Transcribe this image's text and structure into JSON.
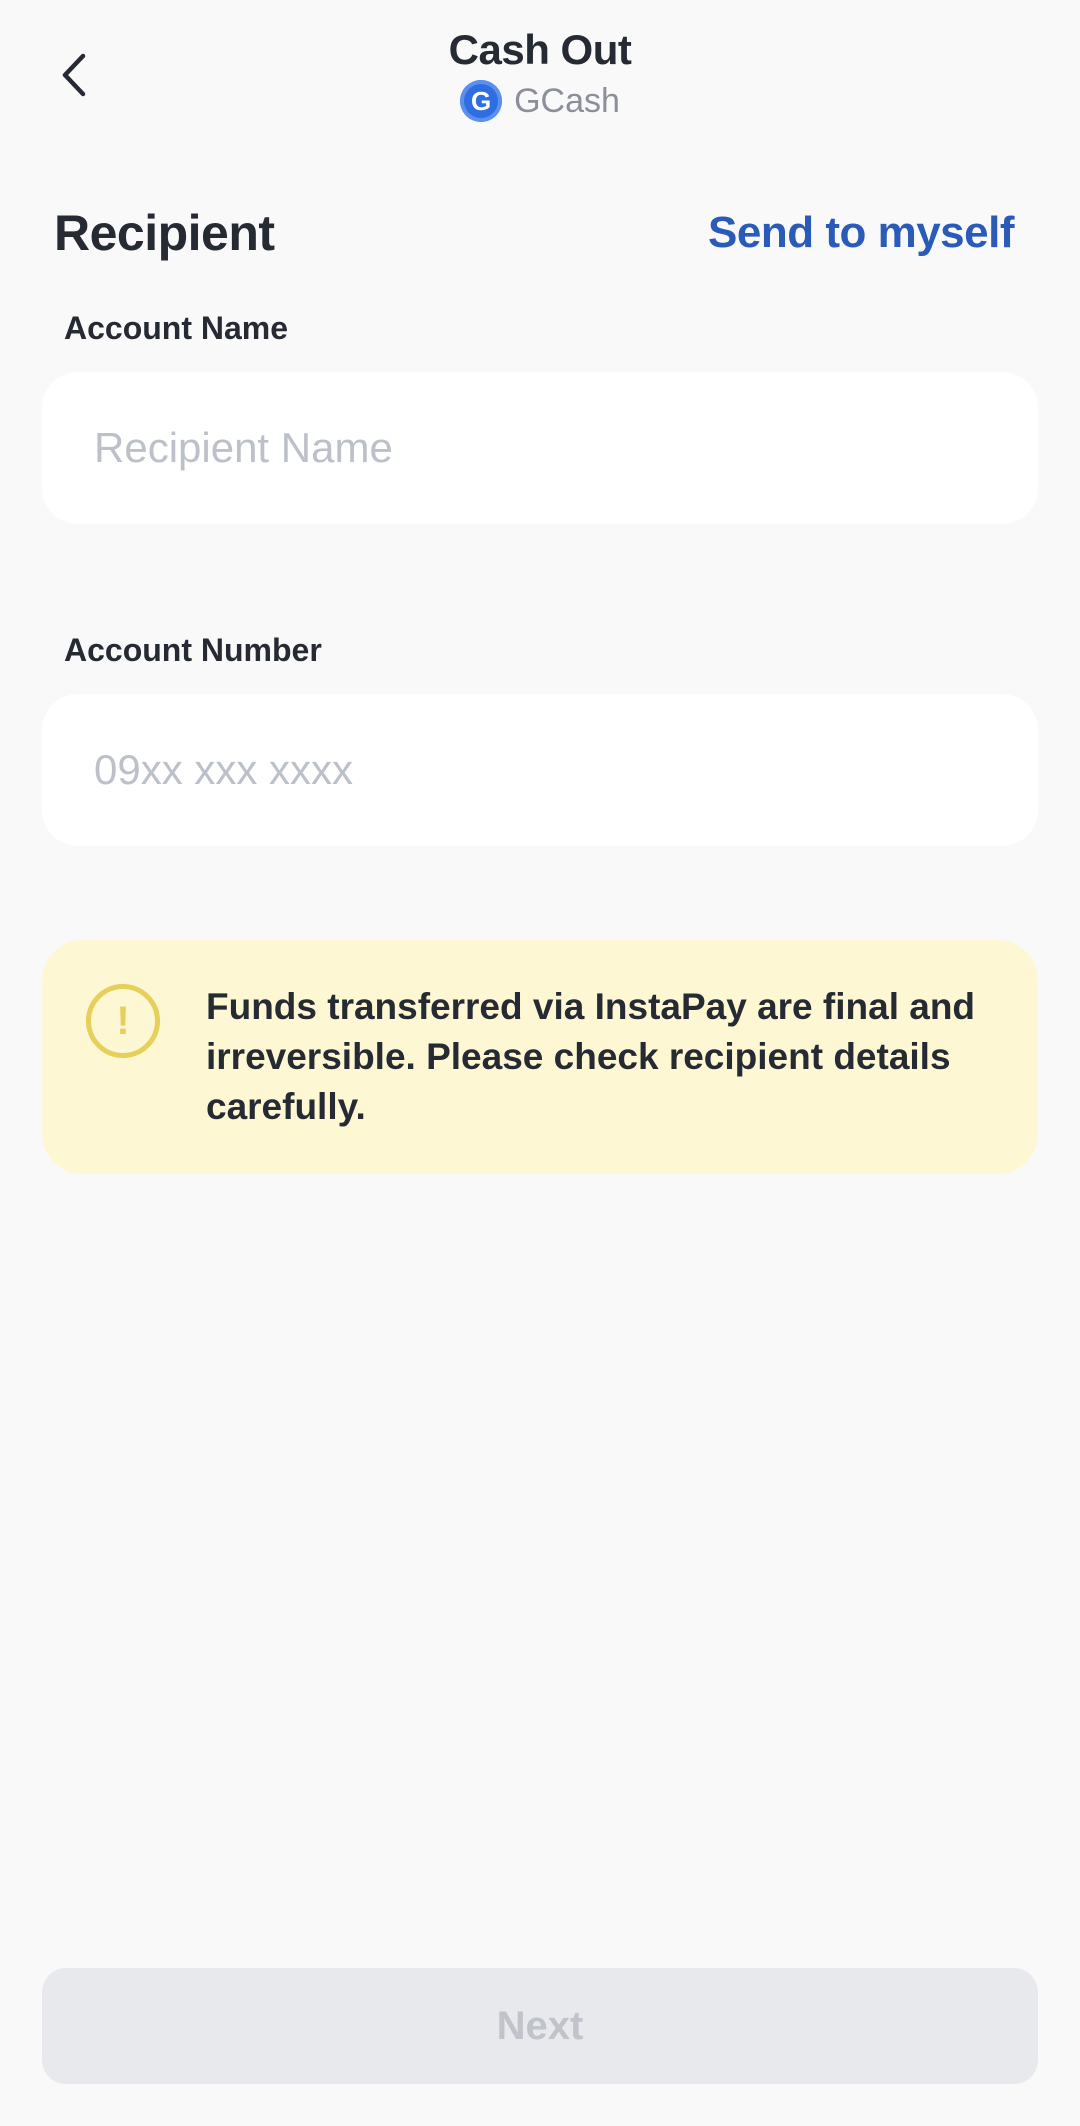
{
  "header": {
    "title": "Cash Out",
    "provider_name": "GCash",
    "provider_logo_letter": "G"
  },
  "recipient": {
    "section_title": "Recipient",
    "send_to_myself_label": "Send to myself"
  },
  "fields": {
    "account_name": {
      "label": "Account Name",
      "placeholder": "Recipient Name",
      "value": ""
    },
    "account_number": {
      "label": "Account Number",
      "placeholder": "09xx xxx xxxx",
      "value": ""
    }
  },
  "warning": {
    "icon_symbol": "!",
    "text": "Funds transferred via InstaPay are final and irreversible. Please check recipient details carefully."
  },
  "footer": {
    "next_label": "Next",
    "next_enabled": false
  },
  "colors": {
    "background": "#f9f9fa",
    "accent": "#2a5bb8",
    "warning_bg": "#fdf7d4",
    "warning_icon": "#e6cf5a",
    "disabled_button_bg": "#e8e9ec",
    "disabled_button_text": "#c0c3ca",
    "brand_blue": "#2f6ee0"
  }
}
